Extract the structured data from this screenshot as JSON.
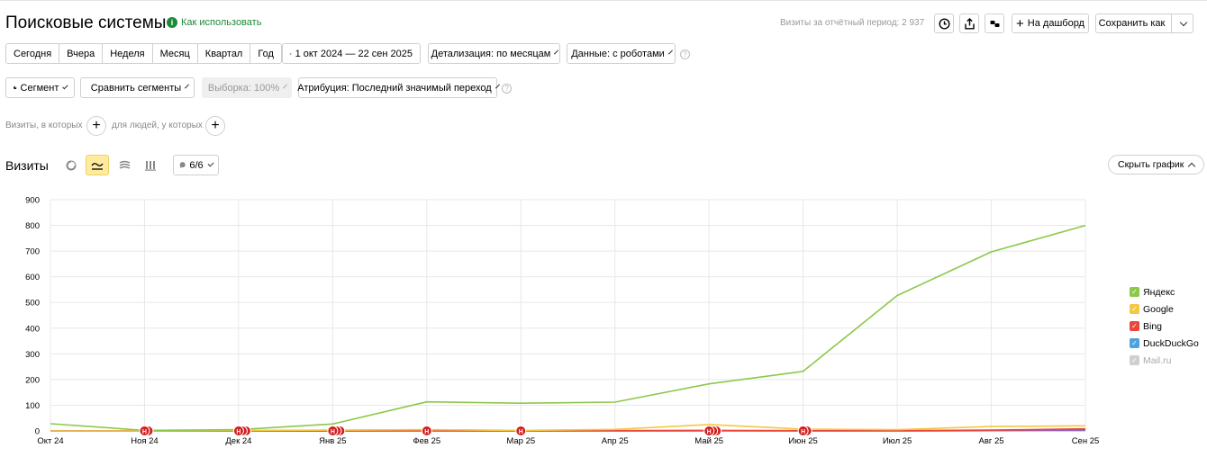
{
  "header": {
    "title": "Поисковые системы",
    "howto": "Как использовать",
    "visits_period": "Визиты за отчётный период: 2 937",
    "add_dashboard": "На дашборд",
    "save_as": "Сохранить как"
  },
  "periods": [
    "Сегодня",
    "Вчера",
    "Неделя",
    "Месяц",
    "Квартал",
    "Год"
  ],
  "date_range": "1 окт 2024 — 22 сен 2025",
  "detail": "Детализация: по месяцам",
  "robots": "Данные: с роботами",
  "segment": "Сегмент",
  "compare": "Сравнить сегменты",
  "sample": "Выборка: 100%",
  "attribution": "Атрибуция: Последний значимый переход",
  "filters": {
    "visits_where": "Визиты, в которых",
    "people_where": "для людей, у которых"
  },
  "chart_header": {
    "title": "Визиты",
    "series_count": "6/6",
    "hide_chart": "Скрыть график"
  },
  "colors": {
    "yandex": "#8cc84b",
    "google": "#f5c842",
    "bing": "#e8473a",
    "duckduckgo": "#4aa3df",
    "mailru": "#bbbbbb",
    "purple": "#9b59b6",
    "accent": "#ffeba0"
  },
  "chart_data": {
    "type": "line",
    "x": [
      "Окт 24",
      "Ноя 24",
      "Дек 24",
      "Янв 25",
      "Фев 25",
      "Мар 25",
      "Апр 25",
      "Май 25",
      "Июн 25",
      "Июл 25",
      "Авг 25",
      "Сен 25"
    ],
    "ylim": [
      0,
      900
    ],
    "yticks": [
      0,
      100,
      200,
      300,
      400,
      500,
      600,
      700,
      800,
      900
    ],
    "grid": true,
    "legend_position": "right",
    "series": [
      {
        "name": "Яндекс",
        "color": "#8cc84b",
        "checked": true,
        "values": [
          28,
          2,
          5,
          27,
          113,
          108,
          112,
          183,
          232,
          527,
          697,
          800
        ]
      },
      {
        "name": "Google",
        "color": "#f5c842",
        "checked": true,
        "values": [
          0,
          0,
          2,
          3,
          5,
          2,
          6,
          25,
          7,
          5,
          17,
          20
        ]
      },
      {
        "name": "Bing",
        "color": "#e8473a",
        "checked": true,
        "values": [
          0,
          0,
          0,
          0,
          1,
          0,
          1,
          2,
          1,
          1,
          3,
          8
        ]
      },
      {
        "name": "DuckDuckGo",
        "color": "#4aa3df",
        "checked": true,
        "values": [
          0,
          0,
          0,
          0,
          0,
          0,
          0,
          1,
          0,
          0,
          1,
          2
        ]
      },
      {
        "name": "Mail.ru",
        "color": "#bbbbbb",
        "checked": true,
        "dim": true,
        "values": [
          0,
          0,
          0,
          0,
          0,
          0,
          0,
          0,
          0,
          0,
          0,
          0
        ]
      },
      {
        "name": "",
        "color": "#9b59b6",
        "checked": true,
        "legend": false,
        "values": [
          0,
          0,
          0,
          0,
          0,
          0,
          0,
          0,
          0,
          0,
          1,
          4
        ]
      }
    ],
    "annotations": [
      {
        "month": 1,
        "count": 2
      },
      {
        "month": 2,
        "count": 3
      },
      {
        "month": 3,
        "count": 3
      },
      {
        "month": 4,
        "count": 1
      },
      {
        "month": 5,
        "count": 1
      },
      {
        "month": 7,
        "count": 3
      },
      {
        "month": 8,
        "count": 2
      }
    ],
    "annotation_label": "Н"
  }
}
